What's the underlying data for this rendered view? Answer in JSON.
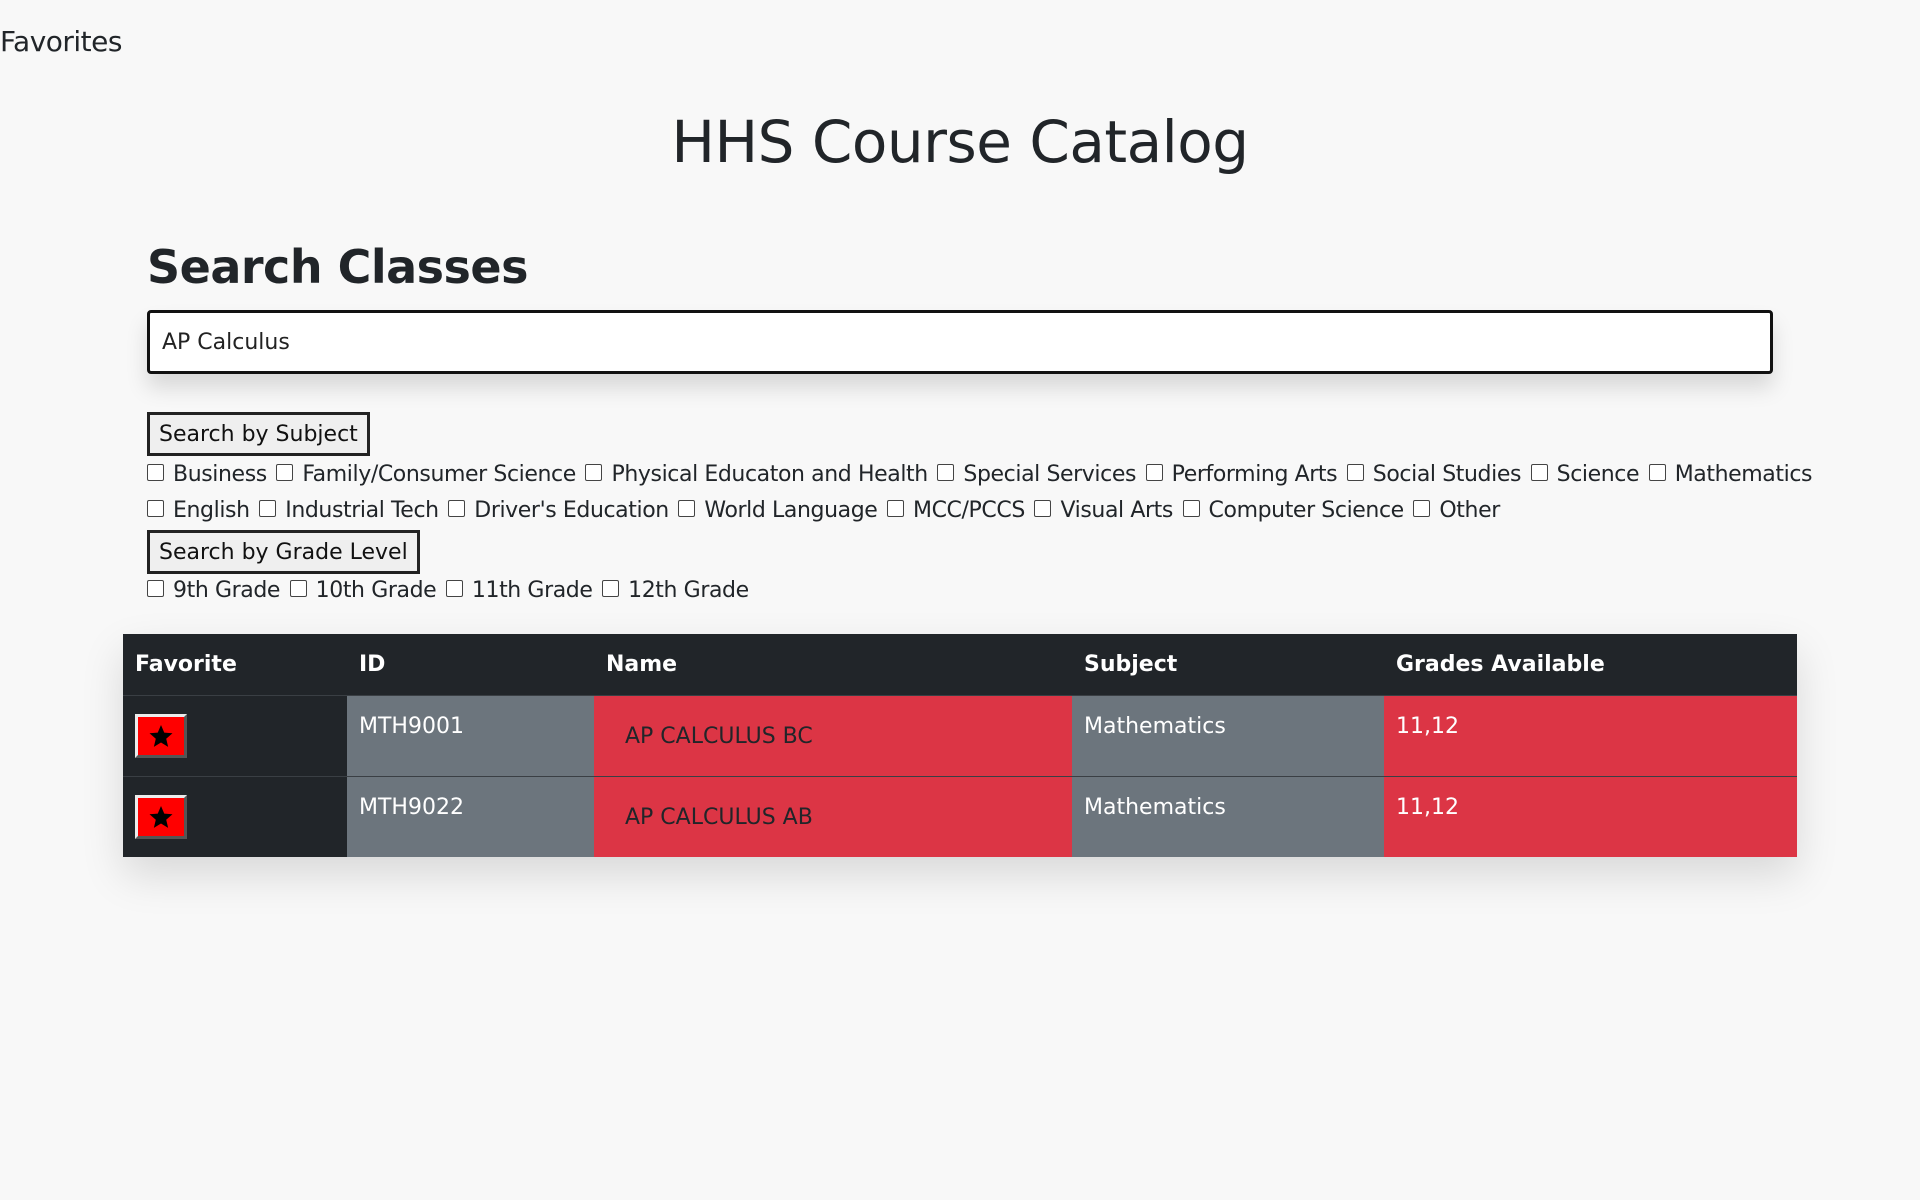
{
  "nav": {
    "favorites_link": "Favorites"
  },
  "page": {
    "title": "HHS Course Catalog"
  },
  "search": {
    "heading": "Search Classes",
    "input_value": "AP Calculus"
  },
  "subject_filter": {
    "button_label": "Search by Subject",
    "row1": [
      "Business",
      "Family/Consumer Science",
      "Physical Educaton and Health",
      "Special Services",
      "Performing Arts",
      "Social Studies",
      "Science",
      "Mathematics"
    ],
    "row2": [
      "English",
      "Industrial Tech",
      "Driver's Education",
      "World Language",
      "MCC/PCCS",
      "Visual Arts",
      "Computer Science",
      "Other"
    ]
  },
  "grade_filter": {
    "button_label": "Search by Grade Level",
    "options": [
      "9th Grade",
      "10th Grade",
      "11th Grade",
      "12th Grade"
    ]
  },
  "table": {
    "headers": [
      "Favorite",
      "ID",
      "Name",
      "Subject",
      "Grades Available"
    ],
    "rows": [
      {
        "id": "MTH9001",
        "name": "AP CALCULUS BC",
        "subject": "Mathematics",
        "grades": "11,12",
        "favorite_icon": "star-icon"
      },
      {
        "id": "MTH9022",
        "name": "AP CALCULUS AB",
        "subject": "Mathematics",
        "grades": "11,12",
        "favorite_icon": "star-icon"
      }
    ]
  },
  "colors": {
    "header_dark": "#212529",
    "cell_gray": "#6c757d",
    "cell_red": "#dc3545",
    "favorite_button": "#ff0000"
  }
}
